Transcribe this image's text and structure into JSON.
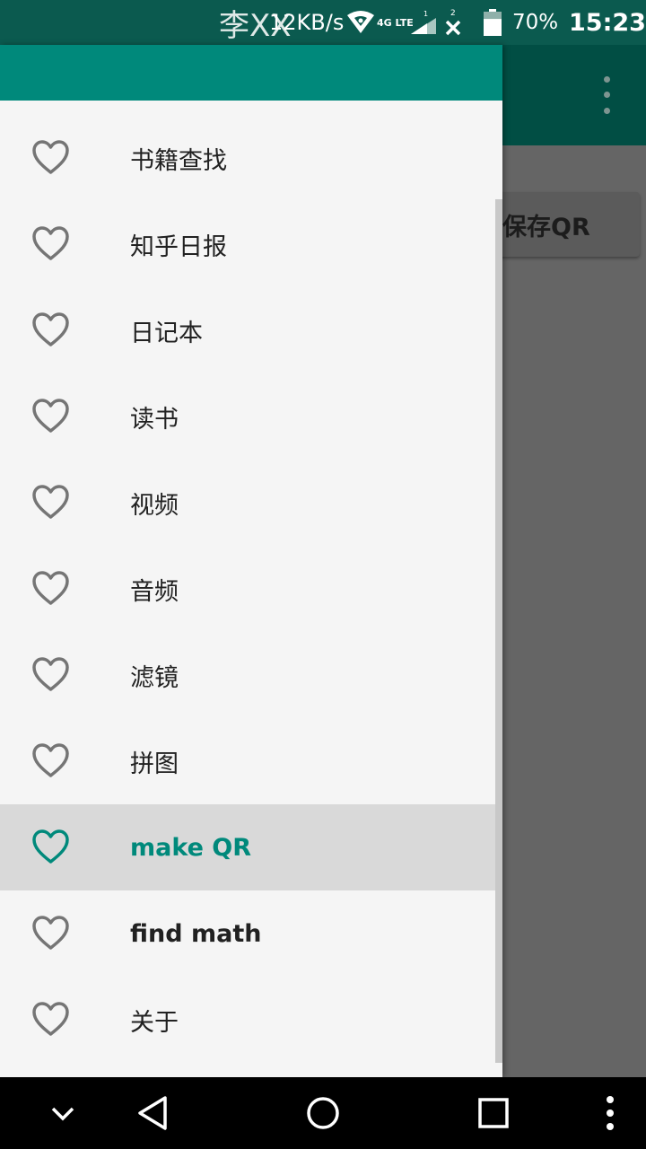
{
  "status_bar": {
    "carrier": "李XX",
    "network_speed": "12KB/s",
    "lte_label": "4G LTE",
    "sim1_label": "1",
    "sim2_label": "2",
    "battery_percent": "70%",
    "battery_level": 0.7,
    "time": "15:23"
  },
  "background": {
    "save_button_label": "保存QR"
  },
  "drawer": {
    "items": [
      {
        "label": "书籍查找",
        "icon": "heart-outline-icon"
      },
      {
        "label": "知乎日报",
        "icon": "heart-outline-icon"
      },
      {
        "label": "日记本",
        "icon": "heart-outline-icon"
      },
      {
        "label": "读书",
        "icon": "heart-outline-icon"
      },
      {
        "label": "视频",
        "icon": "heart-outline-icon"
      },
      {
        "label": "音频",
        "icon": "heart-outline-icon"
      },
      {
        "label": "滤镜",
        "icon": "heart-outline-icon"
      },
      {
        "label": "拼图",
        "icon": "heart-outline-icon"
      },
      {
        "label": "make QR",
        "icon": "heart-outline-icon",
        "selected": true
      },
      {
        "label": "find math",
        "icon": "heart-outline-icon"
      },
      {
        "label": "关于",
        "icon": "heart-outline-icon"
      }
    ]
  },
  "colors": {
    "primary": "#00897b",
    "primary_dark": "#0b5a4f",
    "drawer_bg": "#f5f5f5",
    "selected_bg": "#d9d9d9",
    "icon_gray": "#757575"
  },
  "nav_bar": [
    "chevron-down-icon",
    "back-triangle-icon",
    "home-circle-icon",
    "recents-square-icon",
    "more-vert-icon"
  ]
}
